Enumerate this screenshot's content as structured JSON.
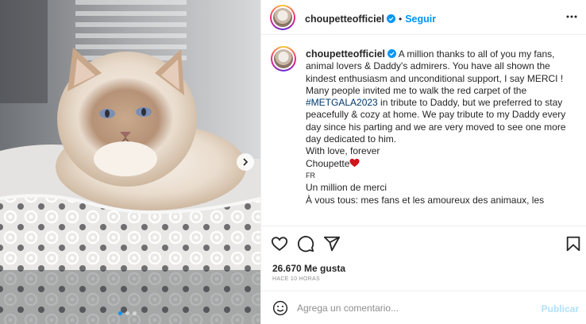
{
  "post": {
    "username": "choupetteofficiel",
    "follow_label": "Seguir",
    "separator": "•",
    "caption": {
      "username": "choupetteofficiel",
      "lines": [
        "A million thanks to all of you my fans, animal lovers & Daddy's admirers. You have all shown the kindest enthusiasm and unconditional support, I say MERCI ! Many people invited me to walk the red carpet of the "
      ],
      "hashtag": "#METGALA2023",
      "after_hashtag": " in tribute to Daddy, but we preferred to stay peacefully & cozy at home. We pay tribute to my Daddy every day since his parting and we are very moved to see one more day dedicated to him.",
      "closing1": "With love, forever",
      "closing2": "Choupette",
      "lang_tag": "FR",
      "fr_line1": "Un million de merci",
      "fr_line2": "À vous tous: mes fans et les amoureux des animaux, les"
    },
    "likes": "26.670 Me gusta",
    "time": "HACE 10 HORAS",
    "comment_placeholder": "Agrega un comentario...",
    "publish_label": "Publicar"
  },
  "icons": {
    "verified": "verified-badge-icon",
    "more": "more-options-icon",
    "like": "heart-outline-icon",
    "comment": "comment-bubble-icon",
    "share": "paper-plane-icon",
    "save": "bookmark-icon",
    "emoji": "smiley-icon",
    "next": "chevron-right-icon"
  },
  "colors": {
    "accent": "#0095f6",
    "hashtag": "#00376b",
    "heart_emoji": "#d1141c",
    "muted": "#8e8e8e"
  },
  "carousel": {
    "count": 3,
    "active": 1
  }
}
